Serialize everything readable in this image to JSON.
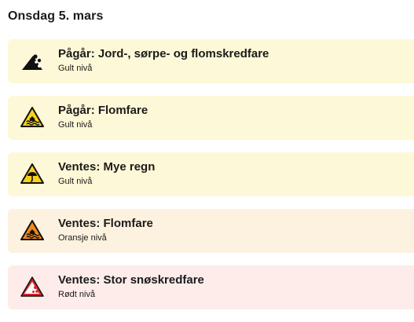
{
  "date_heading": "Onsdag 5. mars",
  "warnings": [
    {
      "title": "Pågår: Jord-, sørpe- og flomskredfare",
      "level": "Gult nivå",
      "icon": "landslide-warning-icon",
      "color": "#fdf8d7"
    },
    {
      "title": "Pågår: Flomfare",
      "level": "Gult nivå",
      "icon": "flood-warning-icon",
      "color": "#fdf8d7"
    },
    {
      "title": "Ventes: Mye regn",
      "level": "Gult nivå",
      "icon": "rain-warning-icon",
      "color": "#fdf8d7"
    },
    {
      "title": "Ventes: Flomfare",
      "level": "Oransje nivå",
      "icon": "flood-warning-icon",
      "color": "#fdf1df"
    },
    {
      "title": "Ventes: Stor snøskredfare",
      "level": "Rødt nivå",
      "icon": "avalanche-warning-icon",
      "color": "#fdecea"
    }
  ]
}
